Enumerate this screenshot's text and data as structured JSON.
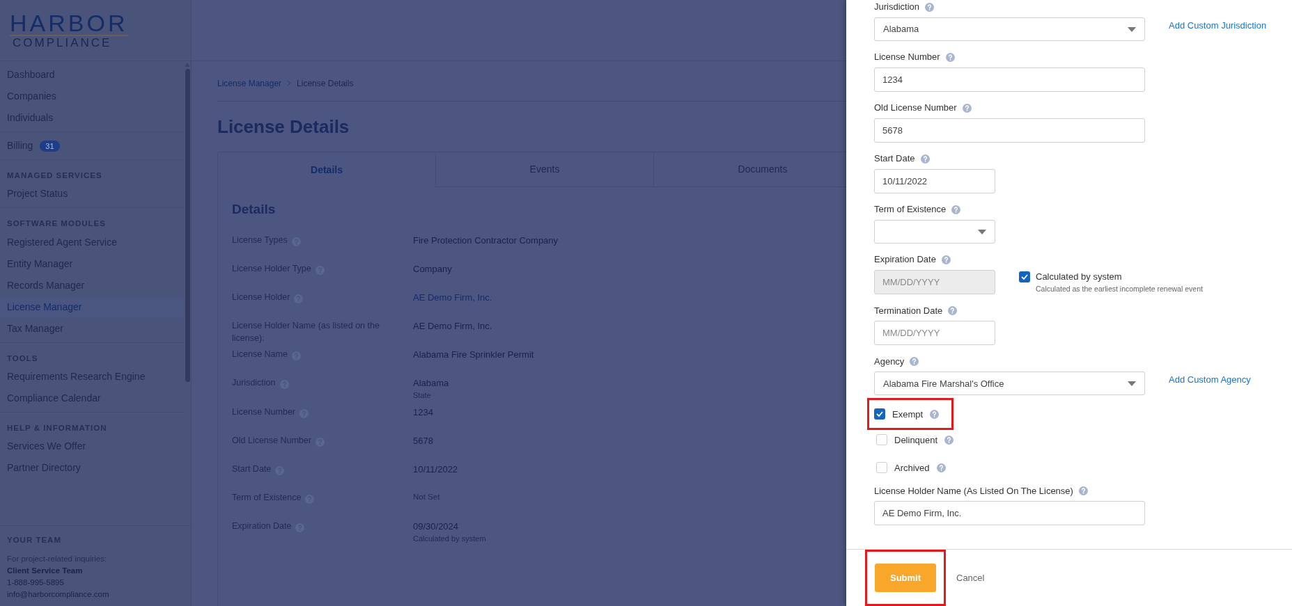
{
  "logo": {
    "line1": "HARBOR",
    "line2": "COMPLIANCE"
  },
  "sidebar": {
    "sections": [
      {
        "items": [
          {
            "label": "Dashboard",
            "selected": false
          },
          {
            "label": "Companies",
            "selected": false
          },
          {
            "label": "Individuals",
            "selected": false
          }
        ]
      },
      {
        "items": [
          {
            "label": "Billing",
            "selected": false,
            "badge": "31"
          }
        ]
      },
      {
        "heading": "MANAGED SERVICES",
        "items": [
          {
            "label": "Project Status",
            "selected": false
          }
        ]
      },
      {
        "heading": "SOFTWARE MODULES",
        "items": [
          {
            "label": "Registered Agent Service",
            "selected": false
          },
          {
            "label": "Entity Manager",
            "selected": false
          },
          {
            "label": "Records Manager",
            "selected": false
          },
          {
            "label": "License Manager",
            "selected": true
          },
          {
            "label": "Tax Manager",
            "selected": false
          }
        ]
      },
      {
        "heading": "TOOLS",
        "items": [
          {
            "label": "Requirements Research Engine",
            "selected": false
          },
          {
            "label": "Compliance Calendar",
            "selected": false
          }
        ]
      },
      {
        "heading": "HELP & INFORMATION",
        "items": [
          {
            "label": "Services We Offer",
            "selected": false
          },
          {
            "label": "Partner Directory",
            "selected": false
          }
        ]
      }
    ],
    "team": {
      "heading": "YOUR TEAM",
      "note": "For project-related inquiries:",
      "name": "Client Service Team",
      "phone": "1-888-995-5895",
      "email": "info@harborcompliance.com"
    }
  },
  "breadcrumb": [
    {
      "label": "License Manager",
      "kind": "link"
    },
    {
      "label": "License Details",
      "kind": "current"
    }
  ],
  "page_title": "License Details",
  "tabs": [
    {
      "label": "Details",
      "selected": true
    },
    {
      "label": "Events",
      "selected": false
    },
    {
      "label": "Documents",
      "selected": false
    }
  ],
  "details": {
    "title": "Details",
    "rows": [
      {
        "label": "License Types",
        "value": "Fire Protection Contractor Company",
        "kind": "text"
      },
      {
        "label": "License Holder Type",
        "value": "Company",
        "kind": "text"
      },
      {
        "label": "License Holder",
        "value": "AE Demo Firm, Inc.",
        "kind": "link"
      },
      {
        "label": "License Holder Name (as listed on the license):",
        "value": "AE Demo Firm, Inc.",
        "kind": "text",
        "help": false
      },
      {
        "label": "License Name",
        "value": "Alabama Fire Sprinkler Permit",
        "kind": "text"
      },
      {
        "label": "Jurisdiction",
        "value": "Alabama",
        "kind": "text",
        "sub": "State"
      },
      {
        "label": "License Number",
        "value": "1234",
        "kind": "text"
      },
      {
        "label": "Old License Number",
        "value": "5678",
        "kind": "text"
      },
      {
        "label": "Start Date",
        "value": "10/11/2022",
        "kind": "text"
      },
      {
        "label": "Term of Existence",
        "value": "Not Set",
        "kind": "muted"
      },
      {
        "label": "Expiration Date",
        "value": "09/30/2024",
        "kind": "text",
        "sub": "Calculated by system"
      }
    ]
  },
  "drawer": {
    "fields": [
      {
        "kind": "select",
        "label": "Jurisdiction",
        "value": "Alabama",
        "wide": true,
        "link": "Add Custom Jurisdiction"
      },
      {
        "kind": "text",
        "label": "License Number",
        "value": "1234",
        "wide": true
      },
      {
        "kind": "text",
        "label": "Old License Number",
        "value": "5678",
        "wide": true
      },
      {
        "kind": "text",
        "label": "Start Date",
        "value": "10/11/2022",
        "wide": false
      },
      {
        "kind": "select",
        "label": "Term of Existence",
        "wide": false
      },
      {
        "kind": "text",
        "label": "Expiration Date",
        "placeholder": "MM/DD/YYYY",
        "wide": false,
        "disabled": true,
        "option": {
          "label": "Calculated by system",
          "checked": true,
          "note": "Calculated as the earliest incomplete renewal event"
        }
      },
      {
        "kind": "text",
        "label": "Termination Date",
        "placeholder": "MM/DD/YYYY",
        "wide": false
      },
      {
        "kind": "select",
        "label": "Agency",
        "value": "Alabama Fire Marshal's Office",
        "wide": true,
        "link": "Add Custom Agency"
      },
      {
        "kind": "checkbox",
        "label": "Exempt",
        "checked": true,
        "highlighted": true
      },
      {
        "kind": "checkbox",
        "label": "Delinquent",
        "checked": false,
        "highlighted": false
      },
      {
        "kind": "checkbox",
        "label": "Archived",
        "checked": false,
        "highlighted": false
      },
      {
        "kind": "text",
        "label": "License Holder Name (As Listed On The License)",
        "value": "AE Demo Firm, Inc.",
        "wide": true
      }
    ],
    "submit": {
      "label": "Submit",
      "highlighted": true
    },
    "cancel": "Cancel"
  }
}
